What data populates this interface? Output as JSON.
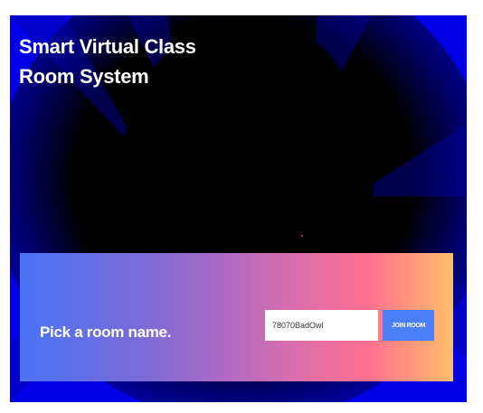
{
  "app": {
    "title": "Smart Virtual Class Room System"
  },
  "room_picker": {
    "prompt": "Pick a room name.",
    "room_name_value": "78070BadOwl",
    "join_button_label": "JOIN ROOM"
  },
  "colors": {
    "background_blue": "#0000e6",
    "gradient_start": "#4a73f5",
    "gradient_end": "#ffbd6b",
    "button_blue": "#4a7ff7"
  }
}
